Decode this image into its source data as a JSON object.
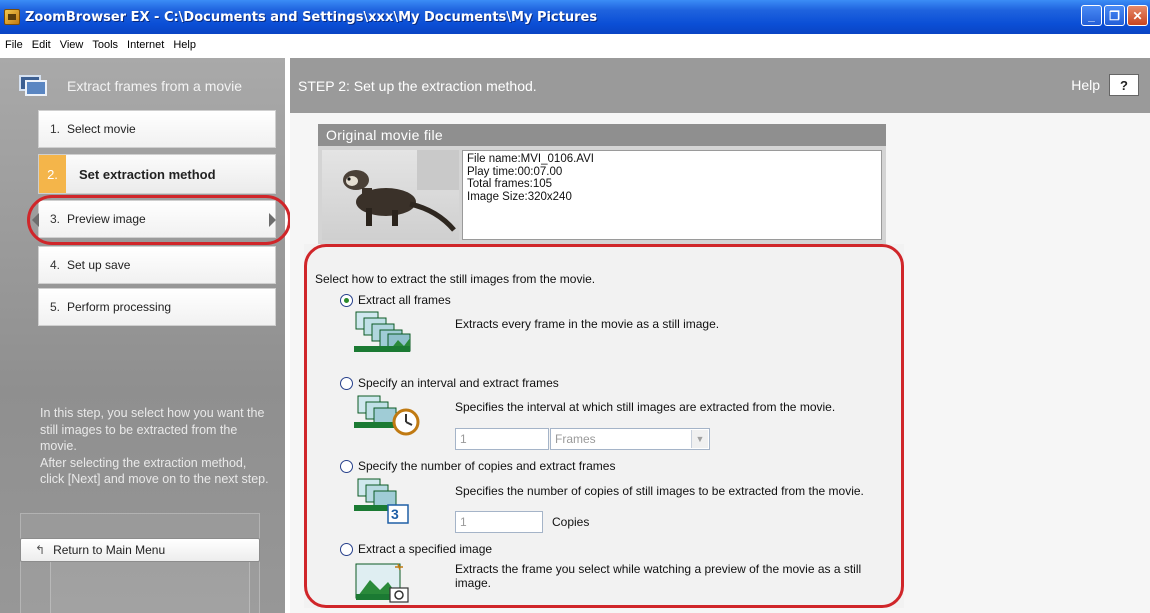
{
  "window": {
    "title": "ZoomBrowser EX  - C:\\Documents and Settings\\xxx\\My Documents\\My Pictures",
    "controls": [
      "minimize",
      "restore",
      "close"
    ]
  },
  "menu": [
    "File",
    "Edit",
    "View",
    "Tools",
    "Internet",
    "Help"
  ],
  "sidebar": {
    "title": "Extract frames from a movie",
    "steps": [
      {
        "num": "1.",
        "label": "Select movie"
      },
      {
        "num": "2.",
        "label": "Set extraction method"
      },
      {
        "num": "3.",
        "label": "Preview image"
      },
      {
        "num": "4.",
        "label": "Set up save"
      },
      {
        "num": "5.",
        "label": "Perform processing"
      }
    ],
    "description": "In this step, you select how you want the still images to be extracted from the movie.\nAfter selecting the extraction method, click [Next] and move on to the next step.",
    "return_label": "Return to Main Menu"
  },
  "main": {
    "step_title": "STEP 2: Set up the extraction method.",
    "help_label": "Help",
    "help_button": "?",
    "original": {
      "title": "Original movie file",
      "file_name": "File name:MVI_0106.AVI",
      "play_time": "Play time:00:07.00",
      "total_frames": "Total frames:105",
      "image_size": "Image Size:320x240"
    },
    "options": {
      "intro": "Select how to extract the still images from the movie.",
      "all": {
        "label": "Extract all frames",
        "desc": "Extracts every frame in the movie as a still image.",
        "selected": true
      },
      "interval": {
        "label": "Specify an interval and extract frames",
        "desc": "Specifies the interval at which still images are extracted from the movie.",
        "value": "1",
        "unit": "Frames",
        "selected": false
      },
      "copies": {
        "label": "Specify the number of copies and extract frames",
        "desc": "Specifies the number of copies of still images to be extracted from the movie.",
        "value": "1",
        "unit": "Copies",
        "badge": "3",
        "selected": false
      },
      "specified": {
        "label": "Extract a specified image",
        "desc": "Extracts the frame you select while watching a preview of the movie as a still image.",
        "selected": false
      }
    }
  },
  "colors": {
    "highlight_outline": "#d0262a",
    "active_step": "#f4b54a",
    "titlebar": "#0b4fd6"
  }
}
